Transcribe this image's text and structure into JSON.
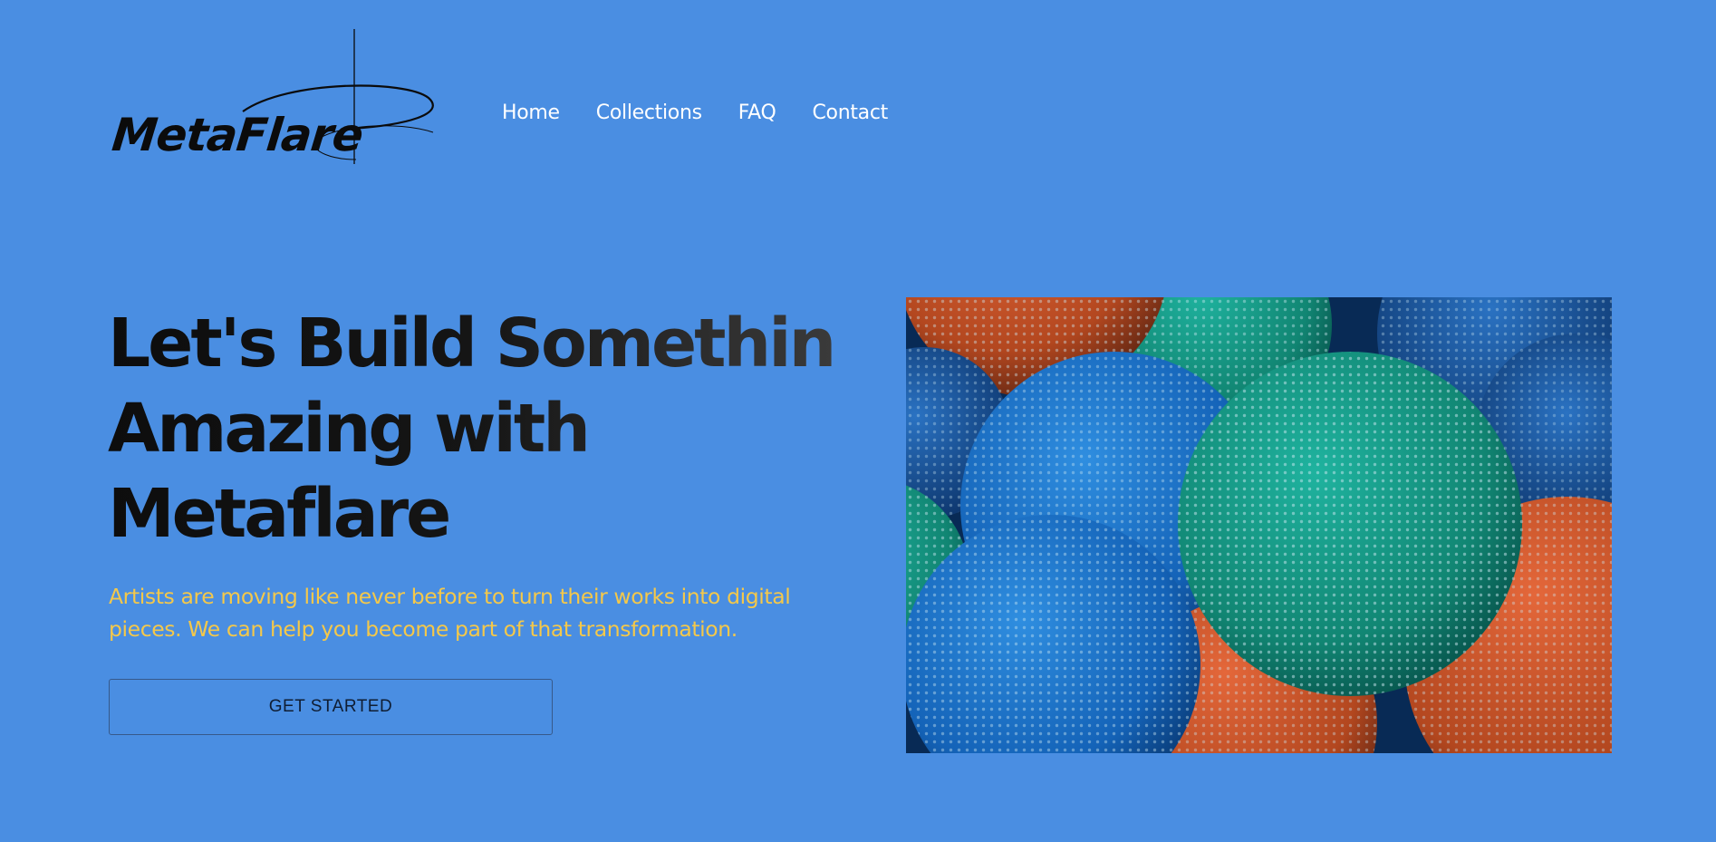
{
  "brand": {
    "name": "MetaFlare"
  },
  "nav": {
    "items": [
      {
        "label": "Home"
      },
      {
        "label": "Collections"
      },
      {
        "label": "FAQ"
      },
      {
        "label": "Contact"
      }
    ]
  },
  "hero": {
    "title_lines": [
      "Let's Build Something",
      "Amazing with",
      "Metaflare"
    ],
    "subtitle": "Artists are moving like never before to turn their works into digital pieces. We can help you become part of that transformation.",
    "cta_label": "GET STARTED",
    "image": "colorful-dotted-spheres-image"
  },
  "colors": {
    "background": "#4a8ee2",
    "subtitle": "#f4c84a",
    "nav_text": "#ffffff",
    "title": "#111111"
  }
}
